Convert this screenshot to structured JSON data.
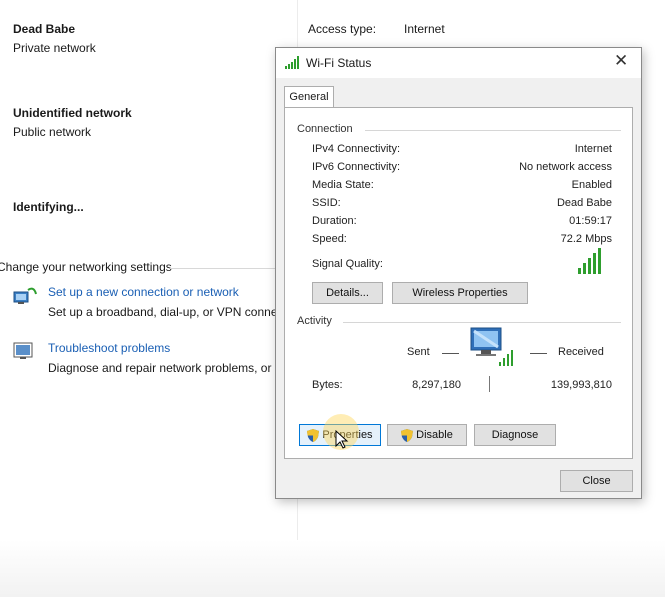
{
  "background": {
    "networks": [
      {
        "name": "Dead Babe",
        "type": "Private network"
      },
      {
        "name": "Unidentified network",
        "type": "Public network"
      },
      {
        "name": "Identifying..."
      }
    ],
    "details_right": {
      "access_type_label": "Access type:",
      "access_type_value": "Internet"
    },
    "change_settings_heading": "Change your networking settings",
    "settings_items": [
      {
        "title": "Set up a new connection or network",
        "desc": "Set up a broadband, dial-up, or VPN conne",
        "icon": "network-setup-icon"
      },
      {
        "title": "Troubleshoot problems",
        "desc": "Diagnose and repair network problems, or",
        "icon": "troubleshoot-icon"
      }
    ]
  },
  "dialog": {
    "title": "Wi-Fi Status",
    "tab": "General",
    "connection": {
      "label": "Connection",
      "rows": [
        {
          "label": "IPv4 Connectivity:",
          "value": "Internet"
        },
        {
          "label": "IPv6 Connectivity:",
          "value": "No network access"
        },
        {
          "label": "Media State:",
          "value": "Enabled"
        },
        {
          "label": "SSID:",
          "value": "Dead Babe"
        },
        {
          "label": "Duration:",
          "value": "01:59:17"
        },
        {
          "label": "Speed:",
          "value": "72.2 Mbps"
        }
      ],
      "signal_label": "Signal Quality:",
      "signal_bars": 5
    },
    "buttons_connection": {
      "details": "Details...",
      "wireless": "Wireless Properties"
    },
    "activity": {
      "label": "Activity",
      "sent_label": "Sent",
      "received_label": "Received",
      "bytes_label": "Bytes:",
      "sent_bytes": "8,297,180",
      "received_bytes": "139,993,810"
    },
    "buttons_activity": {
      "properties": "Properties",
      "disable": "Disable",
      "diagnose": "Diagnose"
    },
    "close_button": "Close"
  },
  "colors": {
    "link": "#1a5fb4",
    "focus": "#0078d7",
    "signal": "#2e9e2e"
  }
}
